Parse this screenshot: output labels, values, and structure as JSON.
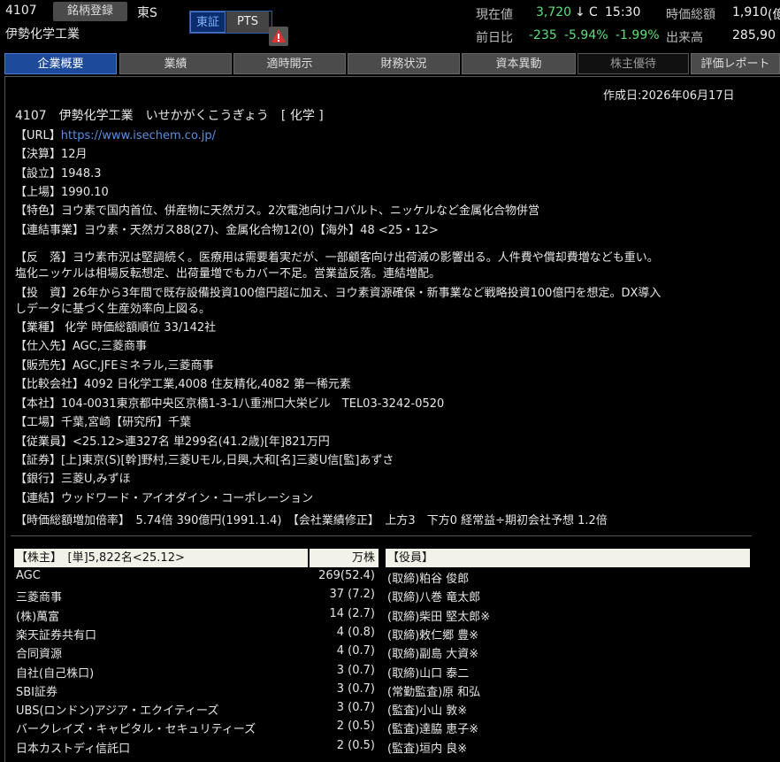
{
  "header": {
    "code": "4107",
    "register_label": "銘柄登録",
    "market": "東S",
    "name": "伊勢化学工業",
    "exchange_tse": "東証",
    "exchange_pts": "PTS",
    "price_label": "現在値",
    "price": "3,720",
    "price_arrow": "↓",
    "price_flag": "C",
    "price_time": "15:30",
    "mcap_label": "時価総額",
    "mcap_value": "1,910",
    "mcap_unit": "(億",
    "change_label": "前日比",
    "change": "-235",
    "change_pct": "-5.94%",
    "change_pct2": "-1.99%",
    "volume_label": "出来高",
    "volume": "285,90"
  },
  "tabs": [
    "企業概要",
    "業績",
    "適時開示",
    "財務状況",
    "資本異動",
    "株主優待",
    "評価レポート"
  ],
  "profile": {
    "created": "作成日:2026年06月17日",
    "title": "4107　伊勢化学工業　いせかがくこうぎょう　[ 化学 ]",
    "url_label": "【URL】",
    "url": "https://www.isechem.co.jp/",
    "lines": [
      "【決算】12月",
      "【設立】1948.3",
      "【上場】1990.10",
      "【特色】ヨウ素で国内首位、併産物に天然ガス。2次電池向けコバルト、ニッケルなど金属化合物併営",
      "【連結事業】ヨウ素・天然ガス88(27)、金属化合物12(0)【海外】48 <25・12>"
    ],
    "lines2": [
      "【反　落】ヨウ素市況は堅調続く。医療用は需要着実だが、一部顧客向け出荷減の影響出る。人件費や償却費増なども重い。",
      "塩化ニッケルは相場反転想定、出荷量増でもカバー不足。営業益反落。連結増配。",
      "【投　資】26年から3年間で既存設備投資100億円超に加え、ヨウ素資源確保・新事業など戦略投資100億円を想定。DX導入",
      "しデータに基づく生産効率向上図る。",
      "【業種】 化学 時価総額順位 33/142社",
      "【仕入先】AGC,三菱商事",
      "【販売先】AGC,JFEミネラル,三菱商事",
      "【比較会社】4092 日化学工業,4008 住友精化,4082 第一稀元素",
      "【本社】104-0031東京都中央区京橋1-3-1八重洲口大栄ビル　TEL03-3242-0520",
      "【工場】千葉,宮崎【研究所】千葉",
      "【従業員】<25.12>連327名 単299名(41.2歳)[年]821万円",
      "【証券】[上]東京(S)[幹]野村,三菱Uモル,日興,大和[名]三菱U信[監]あずさ",
      "【銀行】三菱U,みずほ",
      "【連結】ウッドワード・アイオダイン・コーポレーション",
      "【時価総額増加倍率】　5.74倍 390億円(1991.1.4)　【会社業績修正】　上方3　下方0 経常益÷期初会社予想 1.2倍"
    ]
  },
  "shareholders": {
    "header_name": "【株主】　[単]5,822名<25.12>",
    "header_unit": "万株",
    "rows": [
      {
        "name": "AGC",
        "value": "269(52.4)"
      },
      {
        "name": "三菱商事",
        "value": "37 (7.2)"
      },
      {
        "name": "(株)萬富",
        "value": "14 (2.7)"
      },
      {
        "name": "楽天証券共有口",
        "value": "4 (0.8)"
      },
      {
        "name": "合同資源",
        "value": "4 (0.7)"
      },
      {
        "name": "自社(自己株口)",
        "value": "3 (0.7)"
      },
      {
        "name": "SBI証券",
        "value": "3 (0.7)"
      },
      {
        "name": "UBS(ロンドン)アジア・エクイティーズ",
        "value": "3 (0.7)"
      },
      {
        "name": "バークレイズ・キャピタル・セキュリティーズ",
        "value": "2 (0.5)"
      },
      {
        "name": "日本カストディ信託口",
        "value": "2 (0.5)"
      }
    ]
  },
  "officers": {
    "header": "【役員】",
    "rows": [
      "(取締)粕谷 俊郎",
      "(取締)八巻 竜太郎",
      "(取締)柴田 堅太郎※",
      "(取締)敕仁郷 豊※",
      "(取締)副島 大資※",
      "(取締)山口 泰二",
      "(常勤監査)原 和弘",
      "(監査)小山 敦※",
      "(監査)達脇 恵子※",
      "(監査)垣内 良※"
    ]
  }
}
